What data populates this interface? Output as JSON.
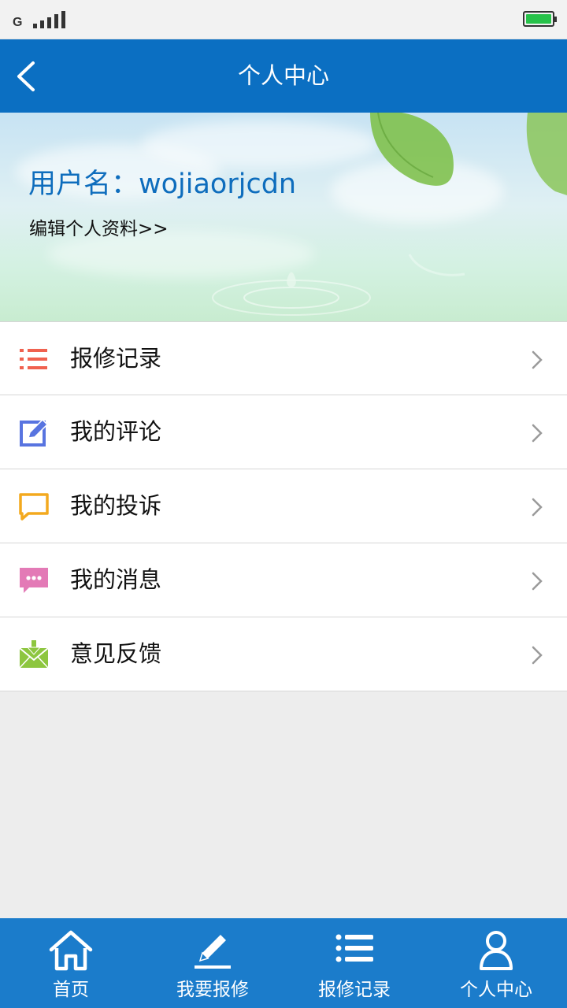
{
  "status_bar": {
    "network_label": "G",
    "signal_icon": "signal-bars-icon",
    "battery_icon": "battery-icon",
    "battery_color": "#27c24a"
  },
  "header": {
    "back_icon": "chevron-left-icon",
    "title": "个人中心",
    "background": "#0b6fc2"
  },
  "profile": {
    "username_label": "用户名：wojiaorjcdn",
    "edit_link": "编辑个人资料>>"
  },
  "menu": {
    "items": [
      {
        "label": "报修记录",
        "icon": "list-icon",
        "color": "#f0614f"
      },
      {
        "label": "我的评论",
        "icon": "edit-icon",
        "color": "#5874e0"
      },
      {
        "label": "我的投诉",
        "icon": "speech-bubble-icon",
        "color": "#f3a91e"
      },
      {
        "label": "我的消息",
        "icon": "message-dots-icon",
        "color": "#e37ab6"
      },
      {
        "label": "意见反馈",
        "icon": "mail-download-icon",
        "color": "#8dc63f"
      }
    ],
    "chevron_icon": "chevron-right-icon"
  },
  "bottom_nav": {
    "background": "#1b7ccb",
    "items": [
      {
        "label": "首页",
        "icon": "home-icon"
      },
      {
        "label": "我要报修",
        "icon": "pencil-icon"
      },
      {
        "label": "报修记录",
        "icon": "list-icon"
      },
      {
        "label": "个人中心",
        "icon": "user-icon",
        "active": true
      }
    ]
  }
}
